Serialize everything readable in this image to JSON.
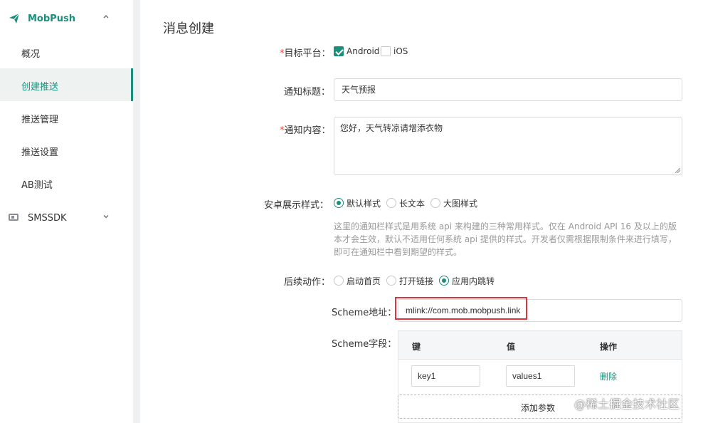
{
  "sidebar": {
    "brand": "MobPush",
    "items": [
      {
        "label": "概况",
        "active": false
      },
      {
        "label": "创建推送",
        "active": true
      },
      {
        "label": "推送管理",
        "active": false
      },
      {
        "label": "推送设置",
        "active": false
      },
      {
        "label": "AB测试",
        "active": false
      }
    ],
    "sms": "SMSSDK"
  },
  "main": {
    "title": "消息创建",
    "platform": {
      "required": "*",
      "label": "目标平台：",
      "options": [
        {
          "label": "Android",
          "checked": true
        },
        {
          "label": "iOS",
          "checked": false
        }
      ]
    },
    "notify_title": {
      "label": "通知标题：",
      "value": "天气预报"
    },
    "notify_content": {
      "required": "*",
      "label": "通知内容：",
      "value": "您好，天气转凉请增添衣物"
    },
    "android_style": {
      "label": "安卓展示样式：",
      "options": [
        {
          "label": "默认样式",
          "checked": true
        },
        {
          "label": "长文本",
          "checked": false
        },
        {
          "label": "大图样式",
          "checked": false
        }
      ],
      "hint_lines": [
        "这里的通知栏样式是用系统 api 来构建的三种常用样式。仅在 Android API 16 及以上的版",
        "本才会生效，默认不适用任何系统 api 提供的样式。开发者仅需根据限制条件来进行填写，",
        "即可在通知栏中看到期望的样式。"
      ]
    },
    "follow_action": {
      "label": "后续动作：",
      "options": [
        {
          "label": "启动首页",
          "checked": false
        },
        {
          "label": "打开链接",
          "checked": false
        },
        {
          "label": "应用内跳转",
          "checked": true
        }
      ]
    },
    "scheme_address": {
      "label": "Scheme地址：",
      "value": "mlink://com.mob.mobpush.link"
    },
    "scheme_fields": {
      "label": "Scheme字段：",
      "headers": [
        "键",
        "值",
        "操作"
      ],
      "rows": [
        {
          "key": "key1",
          "value": "values1",
          "action": "删除"
        }
      ],
      "add_label": "添加参数"
    }
  },
  "watermark": "@稀土掘金技术社区",
  "colors": {
    "accent": "#1c8e7c",
    "highlight": "#d9363e",
    "required": "#e74c3c"
  }
}
